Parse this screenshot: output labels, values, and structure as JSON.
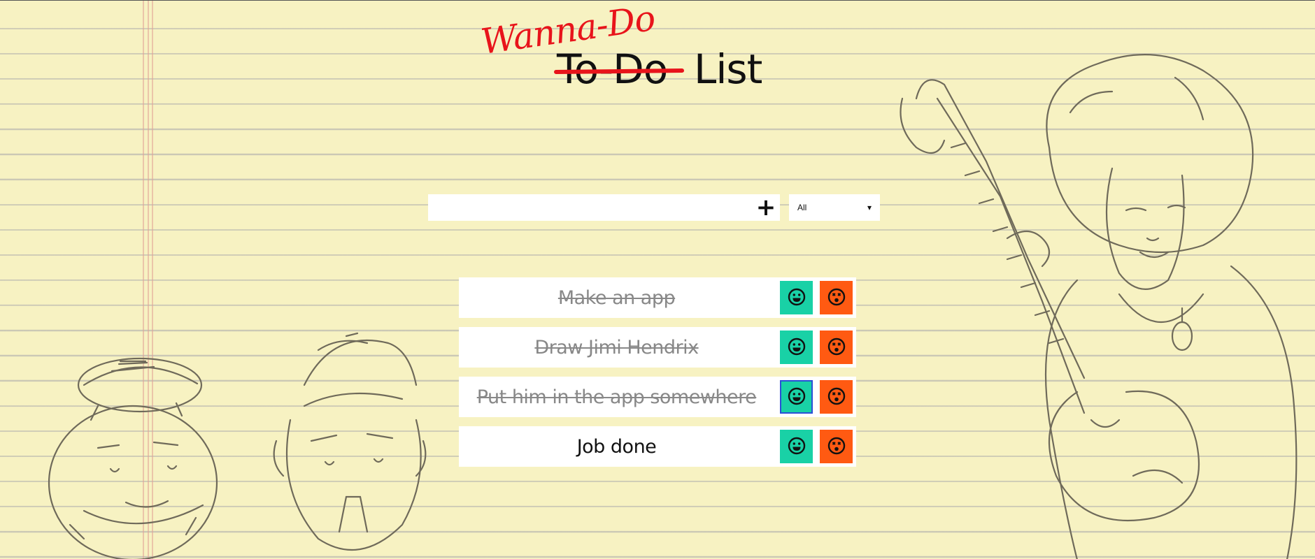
{
  "title": {
    "original": "To-Do",
    "correction": "Wanna-Do",
    "suffix": "List"
  },
  "form": {
    "input_value": "",
    "add_button_label": "+",
    "add_button_icon": "plus-icon",
    "filter_selected": "All",
    "filter_arrow": "▾"
  },
  "todos": [
    {
      "text": "Make an app",
      "completed": true
    },
    {
      "text": "Draw Jimi Hendrix",
      "completed": true
    },
    {
      "text": "Put him in the app somewhere",
      "completed": true
    },
    {
      "text": "Job done",
      "completed": false
    }
  ],
  "icons": {
    "complete": "smile-icon",
    "delete": "dizzy-face-icon"
  },
  "colors": {
    "paper": "#f7f2c2",
    "complete_button": "#19d1a6",
    "delete_button": "#ff5a12",
    "title_accent": "#e8141b"
  }
}
